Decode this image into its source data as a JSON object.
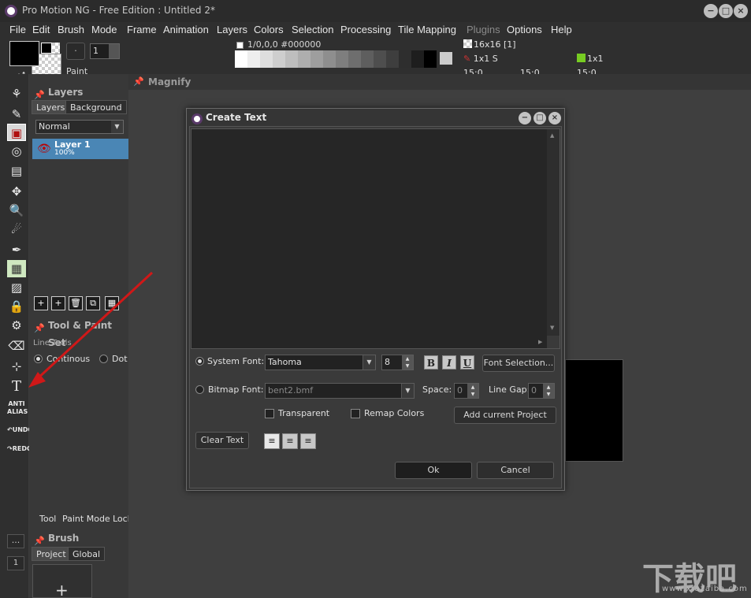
{
  "window": {
    "title": "Pro Motion NG - Free Edition : Untitled 2*",
    "controls": [
      "−",
      "□",
      "×"
    ]
  },
  "menu": [
    "File",
    "Edit",
    "Brush",
    "Mode",
    "Frame",
    "Animation",
    "Layers",
    "Colors",
    "Selection",
    "Processing",
    "Tile Mapping",
    "Plugins",
    "Options",
    "Help"
  ],
  "menu_disabled": "Plugins",
  "toolbar": {
    "paint_label": "Paint",
    "brush_dot": "·",
    "brush_size": "1",
    "color_readout": "1/0,0,0 #000000",
    "palette": [
      "#ffffff",
      "#eeeeee",
      "#dedede",
      "#cecece",
      "#bebebe",
      "#aeaeae",
      "#9e9e9e",
      "#8e8e8e",
      "#7e7e7e",
      "#6e6e6e",
      "#5e5e5e",
      "#4e4e4e",
      "#3e3e3e",
      "#2e2e2e",
      "#1e1e1e",
      "#000000"
    ],
    "grid_size": "16x16 [1]",
    "brush_1x1s": "1x1 S",
    "brush_1x1": "1x1",
    "grid_a": "15:0",
    "grid_b": "15:0",
    "grid_c": "15:0"
  },
  "layers_panel": {
    "title": "Layers",
    "tabs": [
      "Layers",
      "Background"
    ],
    "blend_mode": "Normal",
    "layer": {
      "name": "Layer 1",
      "opacity": "100%"
    },
    "layer_tools": [
      "+",
      "+",
      "🗑",
      "⧉",
      "▦"
    ]
  },
  "tool_settings": {
    "title": "Tool & Paint Set",
    "line_tools_label": "Line Tools",
    "options": [
      "Continous",
      "Dot"
    ],
    "bottom_tabs": [
      "Tool",
      "Paint Mode",
      "Lock"
    ]
  },
  "brush_container": {
    "title": "Brush Container",
    "tabs": [
      "Project",
      "Global"
    ],
    "add": "+"
  },
  "left_tools": {
    "anti_alias": "ANTI ALIAS",
    "undo": "UNDO",
    "redo": "REDO",
    "ellipsis": "...",
    "page": "1"
  },
  "magnify": {
    "title": "Magnify"
  },
  "dialog": {
    "title": "Create Text",
    "system_font_label": "System Font:",
    "system_font": "Tahoma",
    "font_size": "8",
    "bold": "B",
    "italic": "I",
    "underline": "U",
    "font_selection": "Font Selection...",
    "bitmap_font_label": "Bitmap Font:",
    "bitmap_font": "bent2.bmf",
    "space_label": "Space:",
    "space_value": "0",
    "line_gap_label": "Line Gap:",
    "line_gap_value": "0",
    "transparent_label": "Transparent",
    "remap_colors_label": "Remap Colors",
    "add_project": "Add current Project",
    "clear_text": "Clear Text",
    "ok": "Ok",
    "cancel": "Cancel"
  },
  "watermark": {
    "main": "下载吧",
    "sub": "www.xiazaiba.com"
  },
  "colors": {
    "accent": "#4a86b5",
    "arrow": "#d01818"
  }
}
